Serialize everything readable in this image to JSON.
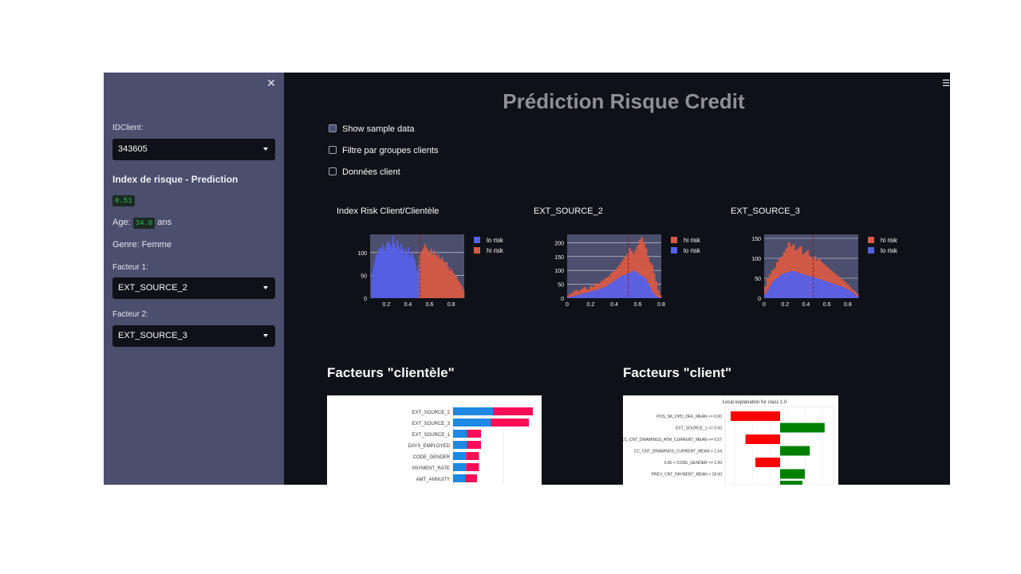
{
  "sidebar": {
    "close_icon": "close-icon",
    "idclient_label": "IDClient:",
    "idclient_value": "343605",
    "risk_heading": "Index de risque - Prediction",
    "risk_value": "0.51",
    "age_label": "Age:",
    "age_value": "34.0",
    "age_unit": "ans",
    "genre_text": "Genre: Femme",
    "facteur1_label": "Facteur 1:",
    "facteur1_value": "EXT_SOURCE_2",
    "facteur2_label": "Facteur 2:",
    "facteur2_value": "EXT_SOURCE_3"
  },
  "main": {
    "menu_icon": "hamburger-icon",
    "title": "Prédiction Risque Credit",
    "checkboxes": [
      {
        "label": "Show sample data",
        "checked": false
      },
      {
        "label": "Filtre par groupes clients",
        "checked": false
      },
      {
        "label": "Données client",
        "checked": false
      }
    ],
    "section_clientele": "Facteurs \"clientèle\"",
    "section_client": "Facteurs \"client\""
  },
  "colors": {
    "lo_risk": "#5560e8",
    "hi_risk": "#d65a45",
    "shap_blue": "#1e88e5",
    "shap_red": "#ff0d57",
    "lime_red": "#ff0000",
    "lime_green": "#008000"
  },
  "chart_data": [
    {
      "type": "bar",
      "title": "Index Risk Client/Clientèle",
      "x_ticks": [
        "0.2",
        "0.4",
        "0.6",
        "0.8"
      ],
      "y_ticks": [
        "0",
        "50",
        "100"
      ],
      "xlim": [
        0.05,
        0.92
      ],
      "ylim": [
        0,
        140
      ],
      "legend": [
        "lo risk",
        "hi risk"
      ],
      "legend_placement": "right",
      "marker_line": 0.51,
      "series": [
        {
          "name": "lo risk",
          "x_range": [
            0.06,
            0.5
          ],
          "values": [
            55,
            70,
            80,
            95,
            98,
            110,
            108,
            112,
            118,
            105,
            115,
            122,
            125,
            118,
            112,
            135,
            120,
            110,
            128,
            115,
            105,
            120,
            110,
            95,
            108,
            100,
            112,
            90,
            100,
            95,
            88,
            80,
            60,
            70
          ]
        },
        {
          "name": "hi risk",
          "x_range": [
            0.5,
            0.92
          ],
          "values": [
            95,
            100,
            105,
            112,
            118,
            110,
            105,
            100,
            108,
            95,
            105,
            98,
            92,
            96,
            88,
            85,
            90,
            80,
            78,
            80,
            70,
            60,
            65,
            60,
            55,
            50,
            48,
            40,
            35,
            30,
            25,
            18
          ]
        }
      ]
    },
    {
      "type": "bar",
      "title": "EXT_SOURCE_2",
      "x_ticks": [
        "0",
        "0.2",
        "0.4",
        "0.6",
        "0.8"
      ],
      "y_ticks": [
        "0",
        "50",
        "100",
        "150",
        "200"
      ],
      "xlim": [
        0,
        0.8
      ],
      "ylim": [
        0,
        230
      ],
      "legend": [
        "hi risk",
        "lo risk"
      ],
      "legend_placement": "right",
      "marker_line": 0.52,
      "series": [
        {
          "name": "hi risk",
          "values": [
            10,
            15,
            20,
            25,
            30,
            25,
            30,
            35,
            40,
            35,
            30,
            45,
            40,
            50,
            55,
            50,
            60,
            65,
            70,
            75,
            80,
            90,
            95,
            100,
            110,
            120,
            130,
            140,
            150,
            160,
            180,
            170,
            160,
            175,
            190,
            210,
            220,
            200,
            180,
            150,
            130,
            120,
            90,
            60,
            30,
            10
          ]
        },
        {
          "name": "lo risk",
          "values": [
            3,
            5,
            6,
            8,
            10,
            12,
            14,
            16,
            18,
            20,
            22,
            24,
            26,
            28,
            30,
            32,
            35,
            38,
            40,
            45,
            50,
            55,
            60,
            65,
            70,
            75,
            80,
            82,
            85,
            90,
            92,
            95,
            100,
            95,
            90,
            85,
            80,
            75,
            70,
            55,
            40,
            25,
            15,
            8,
            3,
            1
          ]
        }
      ]
    },
    {
      "type": "bar",
      "title": "EXT_SOURCE_3",
      "x_ticks": [
        "0",
        "0.2",
        "0.4",
        "0.6",
        "0.8"
      ],
      "y_ticks": [
        "0",
        "50",
        "100",
        "150"
      ],
      "xlim": [
        0,
        0.9
      ],
      "ylim": [
        0,
        160
      ],
      "legend": [
        "hi risk",
        "lo risk"
      ],
      "legend_placement": "right",
      "marker_line": 0.47,
      "series": [
        {
          "name": "hi risk",
          "values": [
            30,
            50,
            60,
            70,
            75,
            90,
            100,
            105,
            115,
            125,
            140,
            130,
            135,
            120,
            125,
            130,
            110,
            115,
            120,
            105,
            100,
            105,
            95,
            100,
            90,
            85,
            80,
            75,
            70,
            65,
            60,
            55,
            50,
            45,
            40,
            35,
            28,
            22,
            18,
            12
          ]
        },
        {
          "name": "lo risk",
          "values": [
            10,
            20,
            30,
            40,
            45,
            50,
            55,
            60,
            62,
            64,
            66,
            68,
            68,
            66,
            64,
            62,
            60,
            58,
            56,
            55,
            54,
            52,
            50,
            48,
            46,
            44,
            42,
            40,
            38,
            36,
            34,
            32,
            30,
            28,
            25,
            22,
            18,
            14,
            10,
            6
          ]
        }
      ]
    },
    {
      "type": "bar",
      "orientation": "horizontal",
      "categories": [
        "EXT_SOURCE_2",
        "EXT_SOURCE_3",
        "EXT_SOURCE_1",
        "DAYS_EMPLOYED",
        "CODE_GENDER",
        "PAYMENT_RATE",
        "AMT_ANNUITY"
      ],
      "series": [
        {
          "name": "blue",
          "values": [
            0.4,
            0.38,
            0.14,
            0.14,
            0.13,
            0.13,
            0.12
          ]
        },
        {
          "name": "red",
          "values": [
            0.4,
            0.38,
            0.14,
            0.14,
            0.13,
            0.13,
            0.12
          ]
        }
      ]
    },
    {
      "type": "bar",
      "orientation": "horizontal",
      "title": "Local explanation for class 1.0",
      "categories": [
        "POS_SK_DPD_DEF_MEAN <= 0.00",
        "EXT_SOURCE_1 <= 0.50",
        "CC_CNT_DRAWINGS_ATM_CURRENT_MEAN <= 0.57",
        "CC_CNT_DRAWINGS_CURRENT_MEAN > 1.54",
        "0.00 < CODE_GENDER <= 1.00",
        "PREV_CNT_PAYMENT_MEAN > 18.00",
        ""
      ],
      "values": [
        -0.1,
        0.09,
        -0.07,
        0.06,
        -0.05,
        0.05,
        0.045
      ]
    }
  ]
}
